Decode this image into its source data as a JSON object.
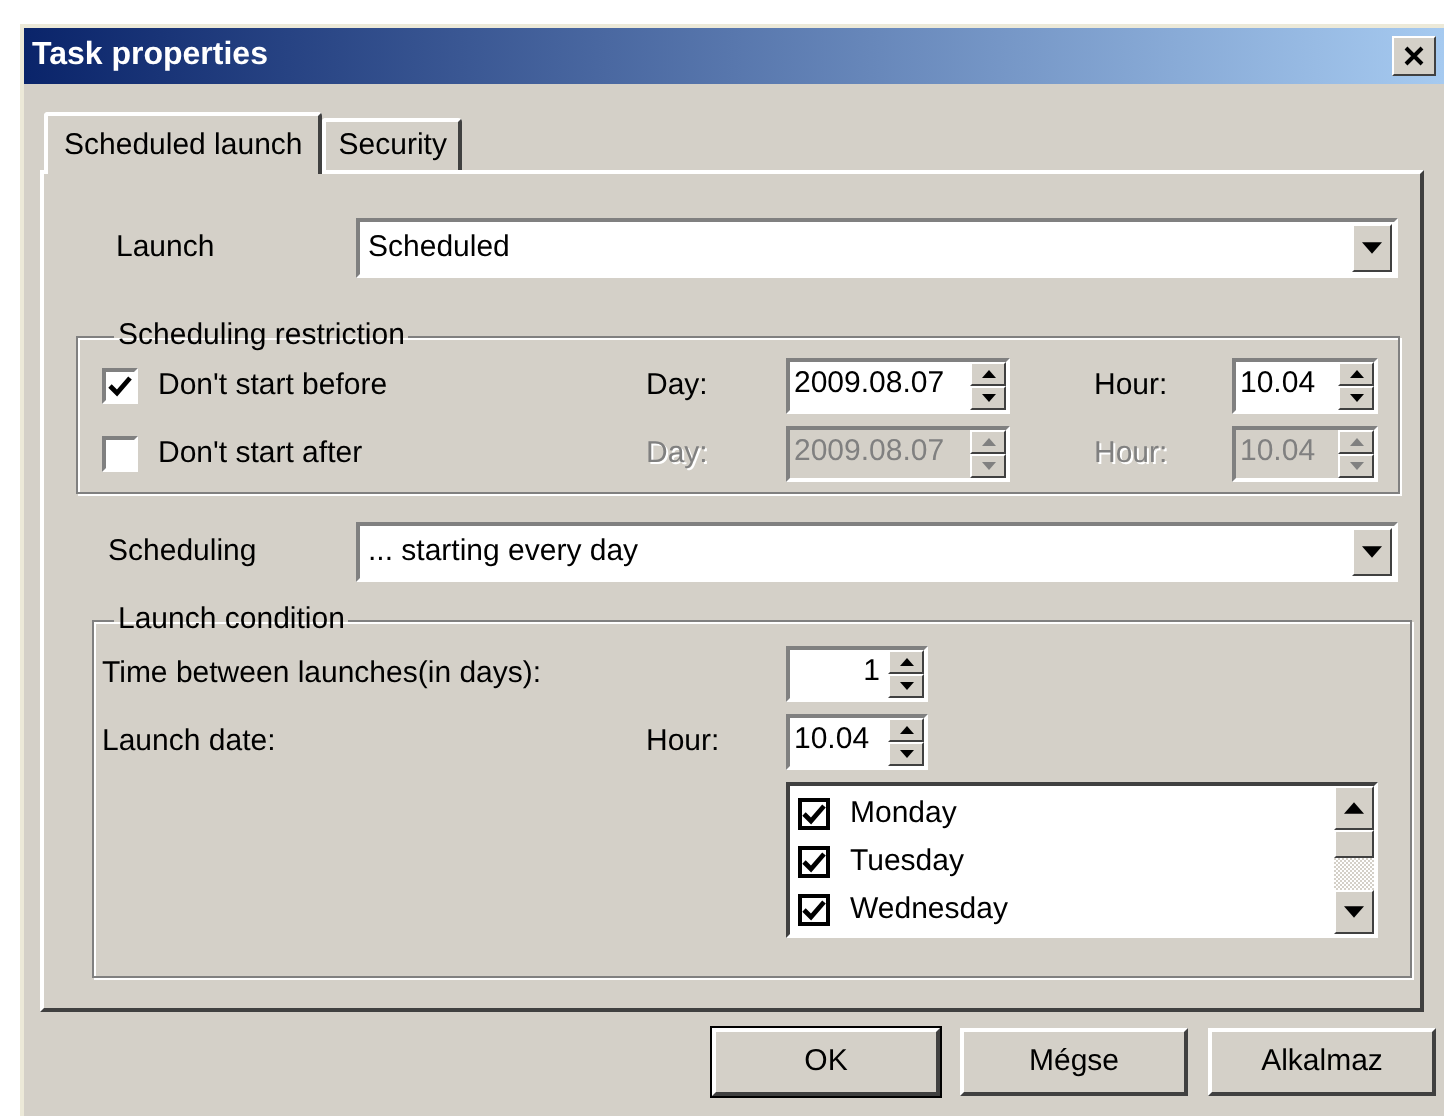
{
  "window": {
    "title": "Task properties"
  },
  "tabs": [
    {
      "label": "Scheduled launch",
      "selected": true
    },
    {
      "label": "Security",
      "selected": false
    }
  ],
  "launch": {
    "label": "Launch",
    "value": "Scheduled"
  },
  "scheduling_restriction": {
    "title": "Scheduling restriction",
    "rows": [
      {
        "label": "Don't start before",
        "checked": true,
        "disabled": false,
        "day_label": "Day:",
        "day": "2009.08.07",
        "hour_label": "Hour:",
        "hour": "10.04"
      },
      {
        "label": "Don't start after",
        "checked": false,
        "disabled": true,
        "day_label": "Day:",
        "day": "2009.08.07",
        "hour_label": "Hour:",
        "hour": "10.04"
      }
    ]
  },
  "scheduling": {
    "label": "Scheduling",
    "value": "... starting every day"
  },
  "launch_condition": {
    "title": "Launch condition",
    "interval_label": "Time between launches(in days):",
    "interval": "1",
    "date_label": "Launch date:",
    "hour_label": "Hour:",
    "hour": "10.04",
    "days": [
      {
        "label": "Monday",
        "checked": true
      },
      {
        "label": "Tuesday",
        "checked": true
      },
      {
        "label": "Wednesday",
        "checked": true
      }
    ]
  },
  "buttons": [
    {
      "label": "OK",
      "default": true
    },
    {
      "label": "Mégse",
      "default": false
    },
    {
      "label": "Alkalmaz",
      "default": false
    }
  ]
}
